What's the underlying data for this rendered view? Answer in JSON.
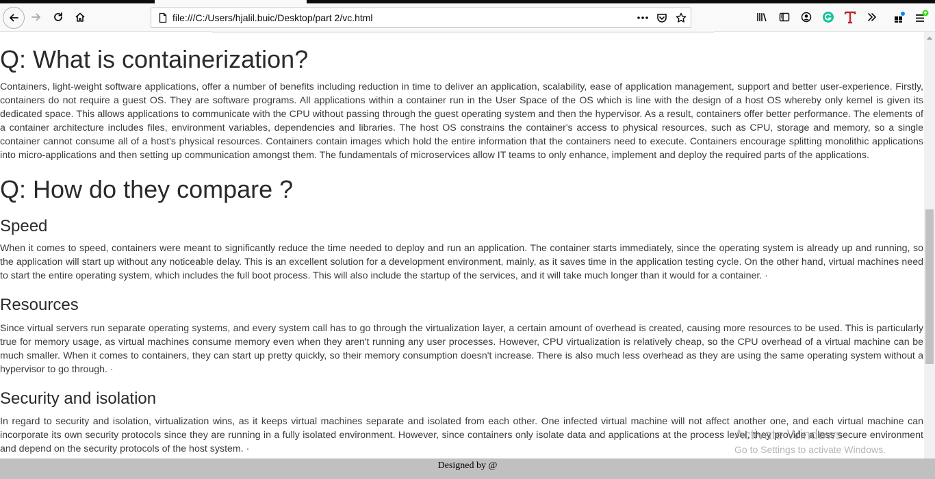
{
  "browser": {
    "url": "file:///C:/Users/hjalil.buic/Desktop/part 2/vc.html",
    "icons": {
      "back": "back-arrow-icon",
      "forward": "forward-arrow-icon",
      "reload": "reload-icon",
      "home": "home-icon",
      "page": "page-icon",
      "more": "more-actions-icon",
      "pocket": "pocket-icon",
      "bookmark": "star-icon",
      "library": "library-icon",
      "sidebar": "sidebar-icon",
      "account": "account-icon",
      "grammarly": "grammarly-icon",
      "translate": "t-extension-icon",
      "overflow": "chevron-double-right-icon",
      "extensions": "extensions-icon",
      "menu": "hamburger-menu-icon"
    }
  },
  "page": {
    "q1_title": "Q: What is containerization?",
    "q1_text": "Containers, light-weight software applications, offer a number of benefits including reduction in time to deliver an application, scalability, ease of application management, support and better user-experience. Firstly, containers do not require a guest OS. They are software programs. All applications within a container run in the User Space of the OS which is line with the design of a host OS whereby only kernel is given its dedicated space. This allows applications to communicate with the CPU without passing through the guest operating system and then the hypervisor. As a result, containers offer better performance. The elements of a container architecture includes files, environment variables, dependencies and libraries. The host OS constrains the container's access to physical resources, such as CPU, storage and memory, so a single container cannot consume all of a host's physical resources. Containers contain images which hold the entire information that the containers need to execute. Containers encourage splitting monolithic applications into micro-applications and then setting up communication amongst them. The fundamentals of microservices allow IT teams to only enhance, implement and deploy the required parts of the applications.",
    "q2_title": "Q: How do they compare ?",
    "speed_title": "Speed",
    "speed_text": "When it comes to speed, containers were meant to significantly reduce the time needed to deploy and run an application. The container starts immediately, since the operating system is already up and running, so the application will start up without any noticeable delay. This is an excellent solution for a development environment, mainly, as it saves time in the application testing cycle. On the other hand, virtual machines need to start the entire operating system, which includes the full boot process. This will also include the startup of the services, and it will take much longer than it would for a container. ·",
    "resources_title": "Resources",
    "resources_text": "Since virtual servers run separate operating systems, and every system call has to go through the virtualization layer, a certain amount of overhead is created, causing more resources to be used. This is particularly true for memory usage, as virtual machines consume memory even when they aren't running any user processes. However, CPU virtualization is relatively cheap, so the CPU overhead of a virtual machine can be much smaller. When it comes to containers, they can start up pretty quickly, so their memory consumption doesn't increase. There is also much less overhead as they are using the same operating system without a hypervisor to go through. ·",
    "security_title": "Security and isolation",
    "security_text": "In regard to security and isolation, virtualization wins, as it keeps virtual machines separate and isolated from each other. One infected virtual machine will not affect another one, and each virtual machine can incorporate its own security protocols since they are running in a fully isolated environment. However, since containers only isolate data and applications at the process level, they provide a less secure environment and depend on the security protocols of the host system. ·"
  },
  "footer": {
    "text": "Designed by @"
  },
  "watermark": {
    "line1": "Activate Windows",
    "line2": "Go to Settings to activate Windows."
  },
  "colors": {
    "footer_bg": "#c0c0c0",
    "toolbar_bg": "#f9f9fa",
    "heading": "#2a2a2a",
    "body_text": "#3a3a3a",
    "grammarly": "#15c39a",
    "translate": "#c0272d"
  }
}
